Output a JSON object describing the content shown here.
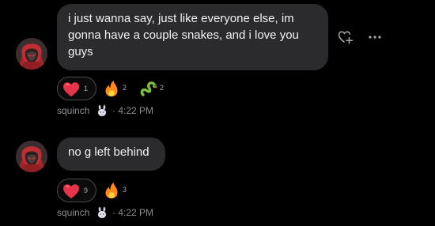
{
  "messages": [
    {
      "author": "squinch",
      "text": "i just wanna say, just like everyone else, im\ngonna have a couple snakes, and i love you\nguys",
      "time": "· 4:22 PM",
      "reactions": [
        {
          "emoji": "heart",
          "count": "1"
        },
        {
          "emoji": "fire",
          "count": "2"
        },
        {
          "emoji": "snake",
          "count": "2"
        }
      ]
    },
    {
      "author": "squinch",
      "text": "no g left behind",
      "time": "· 4:22 PM",
      "reactions": [
        {
          "emoji": "heart",
          "count": "9"
        },
        {
          "emoji": "fire",
          "count": "3"
        }
      ]
    }
  ],
  "colors": {
    "background": "#000000",
    "bubble": "#2b2b2e",
    "heart": "#e8344a",
    "fire": "#ff8a1a",
    "snake": "#7fbf3f"
  },
  "icons": {
    "add_reaction": "heart-plus-icon",
    "more": "more-dots-icon",
    "badge": "bunny-badge-icon"
  }
}
